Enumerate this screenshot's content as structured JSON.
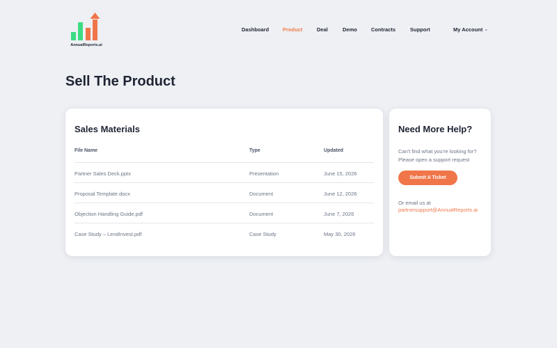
{
  "colors": {
    "accent": "#f0764a",
    "bar_green": "#3ddc84",
    "bar_orange": "#f0764a",
    "background": "#eef0f4"
  },
  "header": {
    "logo_text": "AnnualReports.ai",
    "nav": [
      {
        "label": "Dashboard",
        "active": false
      },
      {
        "label": "Product",
        "active": true
      },
      {
        "label": "Deal",
        "active": false
      },
      {
        "label": "Demo",
        "active": false
      },
      {
        "label": "Contracts",
        "active": false
      },
      {
        "label": "Support",
        "active": false
      }
    ],
    "account_label": "My Account",
    "account_icon": "chevron-down-icon"
  },
  "page": {
    "title": "Sell The Product"
  },
  "materials": {
    "title": "Sales Materials",
    "columns": [
      "File Name",
      "Type",
      "Updated"
    ],
    "rows": [
      [
        "Partner Sales Deck.pptx",
        "Presentation",
        "June 15, 2026"
      ],
      [
        "Proposal Template.docx",
        "Document",
        "June 12, 2026"
      ],
      [
        "Objection Handling Guide.pdf",
        "Document",
        "June 7, 2026"
      ],
      [
        "Case Study – LendInvest.pdf",
        "Case Study",
        "May 30, 2026"
      ]
    ]
  },
  "help": {
    "title": "Need More Help?",
    "text": "Can't find what you're looking for? Please open a support request",
    "button_label": "Submit A Ticket",
    "email_label": "Or email us at",
    "email": "partnersupport@AnnualReports.ai"
  }
}
